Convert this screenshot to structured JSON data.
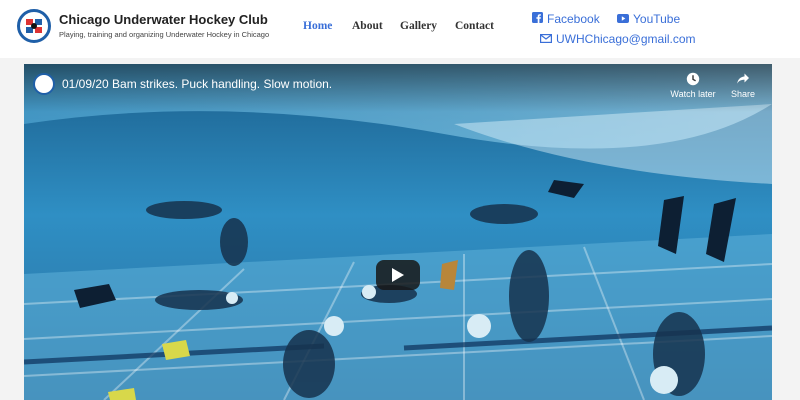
{
  "site": {
    "title": "Chicago Underwater Hockey Club",
    "tagline": "Playing, training and organizing Underwater Hockey in Chicago"
  },
  "nav": {
    "items": [
      {
        "label": "Home",
        "active": true
      },
      {
        "label": "About",
        "active": false
      },
      {
        "label": "Gallery",
        "active": false
      },
      {
        "label": "Contact",
        "active": false
      }
    ]
  },
  "social": {
    "facebook": "Facebook",
    "youtube": "YouTube",
    "email": "UWHChicago@gmail.com"
  },
  "video": {
    "title": "01/09/20 Bam strikes. Puck handling. Slow motion.",
    "watch_later": "Watch later",
    "share": "Share"
  },
  "colors": {
    "accent": "#3a6fd8",
    "logo_blue": "#1f5fa8",
    "pool_water": "#2a7fb6"
  },
  "icons": [
    "facebook-icon",
    "youtube-icon",
    "mail-icon",
    "clock-icon",
    "share-icon",
    "play-icon"
  ]
}
